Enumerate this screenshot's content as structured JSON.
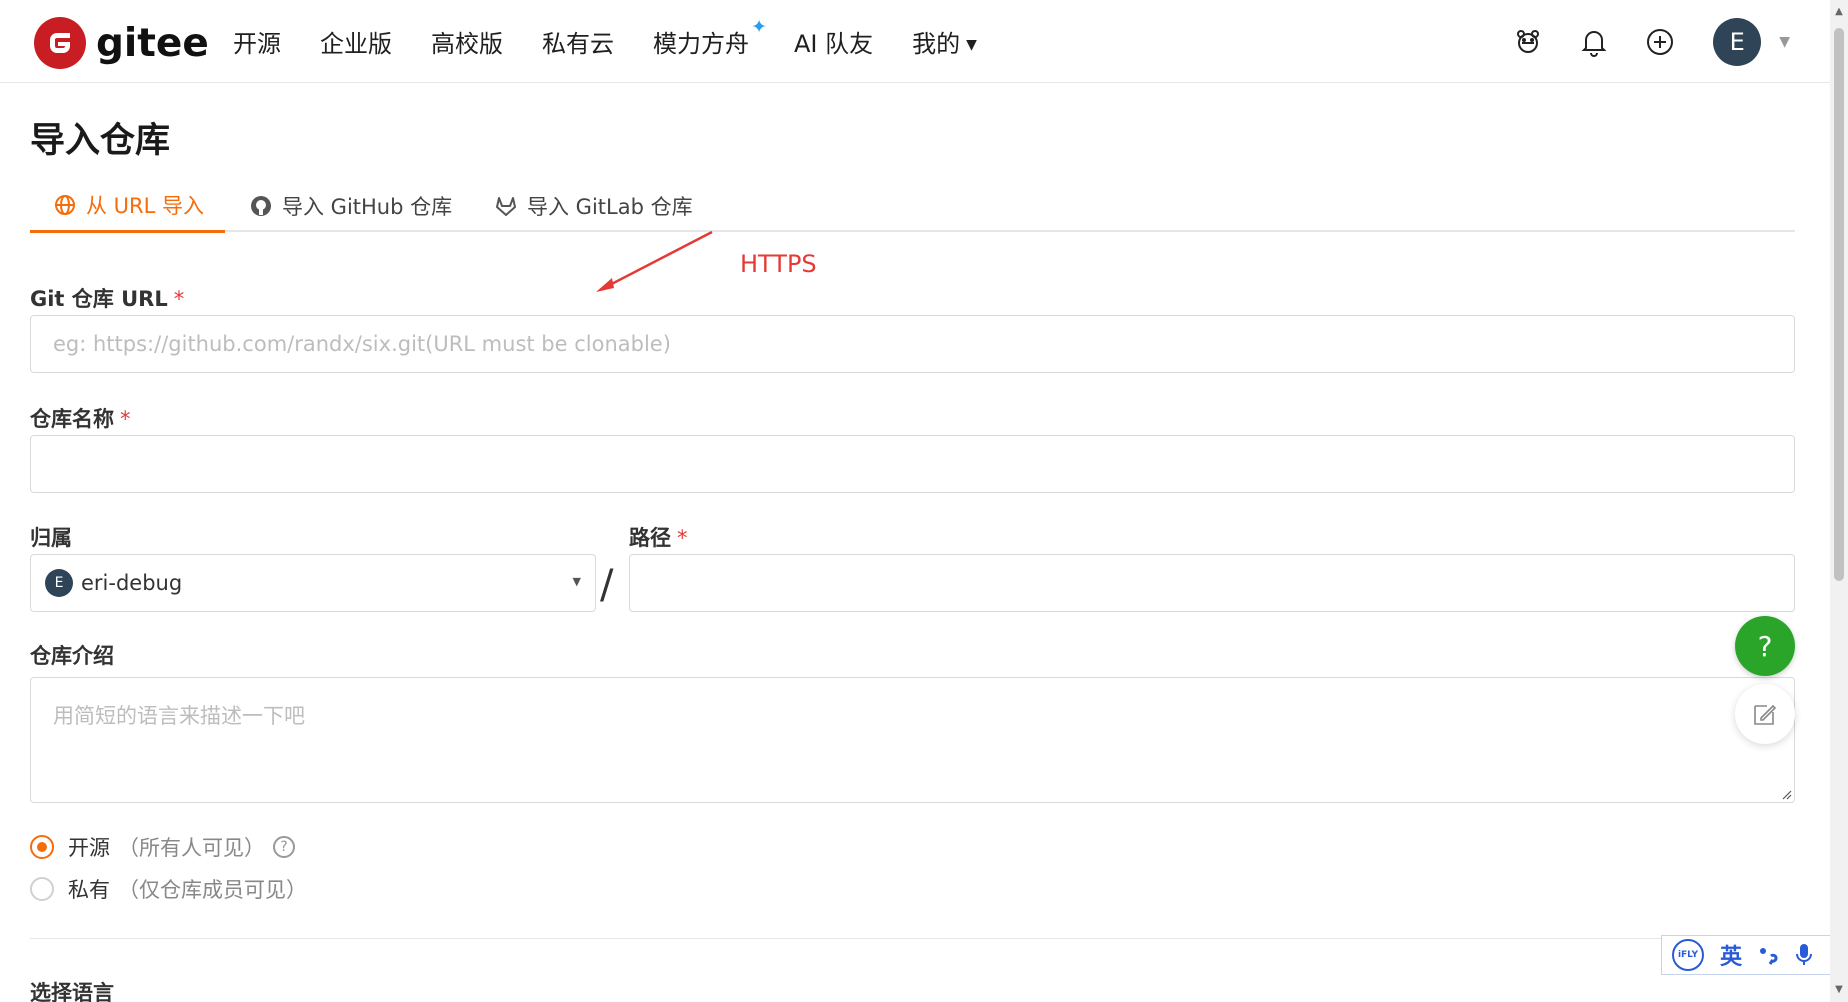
{
  "nav": {
    "brand": "gitee",
    "items": [
      "开源",
      "企业版",
      "高校版",
      "私有云",
      "模力方舟",
      "AI 队友",
      "我的"
    ],
    "avatar_initial": "E"
  },
  "page": {
    "title": "导入仓库"
  },
  "tabs": [
    {
      "label": "从 URL 导入",
      "active": true
    },
    {
      "label": "导入 GitHub 仓库",
      "active": false
    },
    {
      "label": "导入 GitLab 仓库",
      "active": false
    }
  ],
  "annotation": {
    "text": "HTTPS",
    "color": "#e53935"
  },
  "form": {
    "git_url": {
      "label": "Git 仓库 URL",
      "required": "*",
      "placeholder": "eg: https://github.com/randx/six.git(URL must be clonable)"
    },
    "repo_name": {
      "label": "仓库名称",
      "required": "*",
      "value": ""
    },
    "owner": {
      "label": "归属",
      "avatar_initial": "E",
      "value": "eri-debug"
    },
    "separator": "/",
    "path": {
      "label": "路径",
      "required": "*",
      "value": ""
    },
    "description": {
      "label": "仓库介绍",
      "placeholder": "用简短的语言来描述一下吧"
    },
    "visibility": [
      {
        "label": "开源",
        "hint": "（所有人可见）",
        "selected": true,
        "help_icon": true
      },
      {
        "label": "私有",
        "hint": "（仅仓库成员可见）",
        "selected": false
      }
    ],
    "language_section": "选择语言"
  },
  "floating": {
    "help_label": "?"
  },
  "ime_bar": {
    "logo": "iFLY",
    "mode": "英"
  },
  "colors": {
    "accent": "#f56c0b",
    "brand_red": "#c71d23",
    "help_green": "#2aa52a",
    "avatar_bg": "#2f4456"
  }
}
